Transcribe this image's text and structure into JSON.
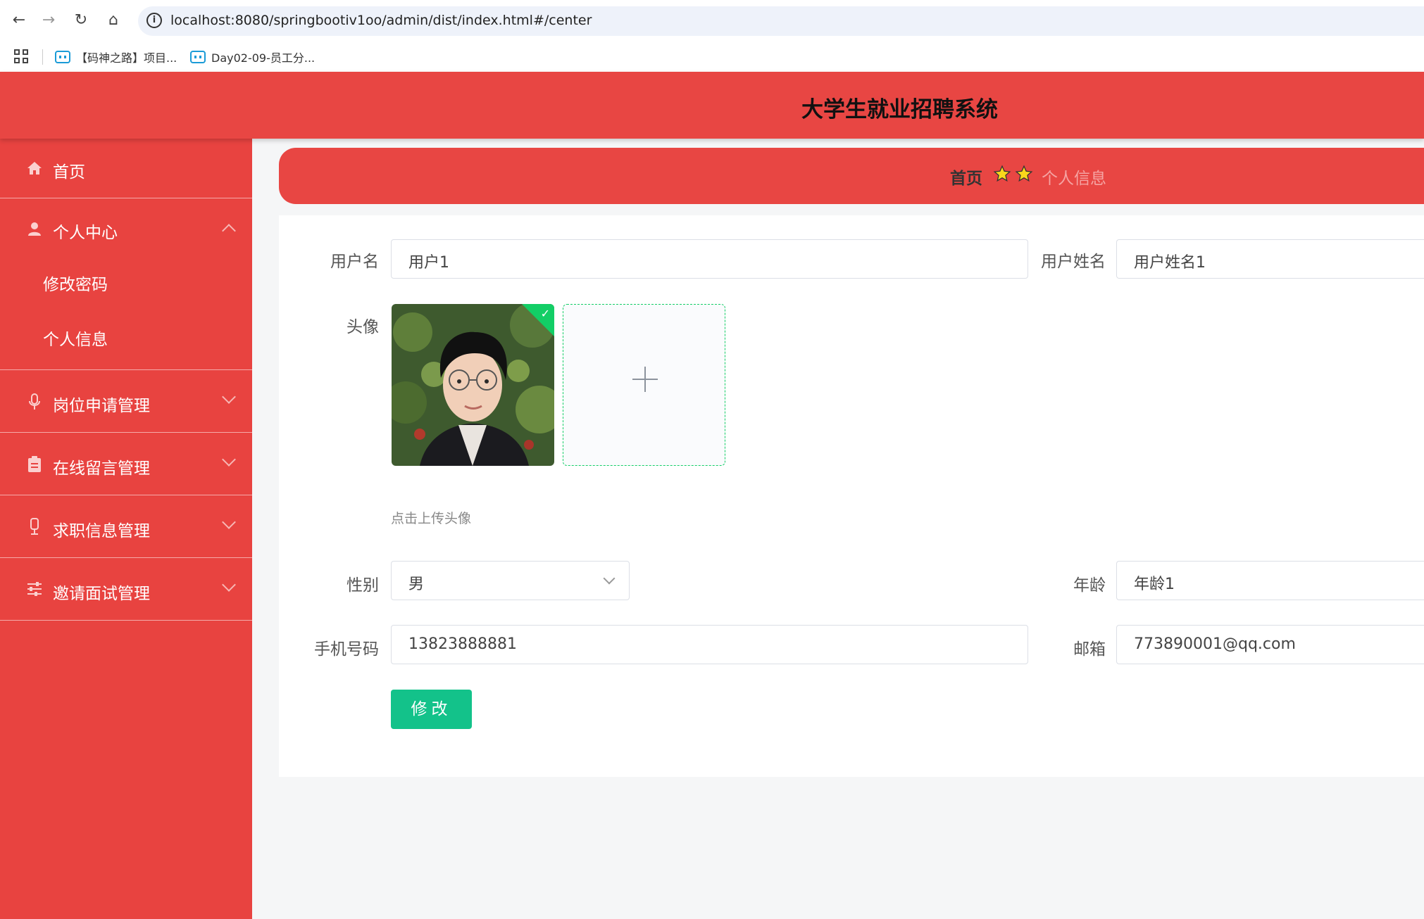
{
  "browser": {
    "url": "localhost:8080/springbootiv1oo/admin/dist/index.html#/center",
    "bookmarks": [
      "【码神之路】项目...",
      "Day02-09-员工分..."
    ]
  },
  "header": {
    "title": "大学生就业招聘系统"
  },
  "sidebar": {
    "items": [
      {
        "label": "首页",
        "icon": "home-icon"
      },
      {
        "label": "个人中心",
        "icon": "user-icon",
        "expanded": true,
        "children": [
          "修改密码",
          "个人信息"
        ]
      },
      {
        "label": "岗位申请管理",
        "icon": "microphone-icon"
      },
      {
        "label": "在线留言管理",
        "icon": "clipboard-icon"
      },
      {
        "label": "求职信息管理",
        "icon": "mic-stand-icon"
      },
      {
        "label": "邀请面试管理",
        "icon": "sliders-icon"
      }
    ]
  },
  "breadcrumb": {
    "home": "首页",
    "current": "个人信息"
  },
  "form": {
    "username_label": "用户名",
    "username_value": "用户1",
    "realname_label": "用户姓名",
    "realname_value": "用户姓名1",
    "avatar_label": "头像",
    "upload_hint": "点击上传头像",
    "gender_label": "性别",
    "gender_value": "男",
    "age_label": "年龄",
    "age_value": "年龄1",
    "phone_label": "手机号码",
    "phone_value": "13823888881",
    "email_label": "邮箱",
    "email_value": "773890001@qq.com",
    "submit_label": "修改"
  },
  "colors": {
    "primary_red": "#e84643",
    "success_green": "#13c28a",
    "background": "#f5f6f7"
  }
}
